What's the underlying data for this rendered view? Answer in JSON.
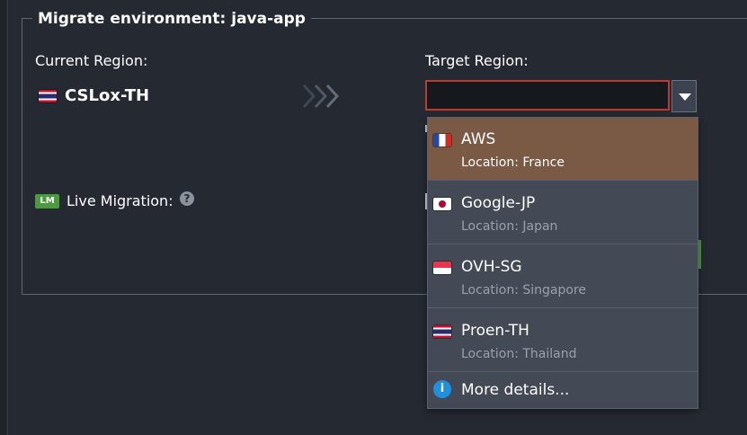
{
  "dialog": {
    "title": "Migrate environment: java-app"
  },
  "source": {
    "label": "Current Region:",
    "flag": "flag-thailand",
    "name": "CSLox-TH"
  },
  "target": {
    "label": "Target Region:",
    "value": "",
    "error_border_color": "#c0392b"
  },
  "live_migration": {
    "badge": "LM",
    "label": "Live Migration:",
    "help_icon": "question-circle-icon"
  },
  "dropdown": {
    "options": [
      {
        "name": "AWS",
        "location": "Location: France",
        "flag": "flag-france",
        "selected": true
      },
      {
        "name": "Google-JP",
        "location": "Location: Japan",
        "flag": "flag-japan",
        "selected": false
      },
      {
        "name": "OVH-SG",
        "location": "Location: Singapore",
        "flag": "flag-singapore",
        "selected": false
      },
      {
        "name": "Proen-TH",
        "location": "Location: Thailand",
        "flag": "flag-thailand",
        "selected": false
      }
    ],
    "more_icon": "info-icon",
    "more_label": "More details..."
  },
  "colors": {
    "background": "#252a32",
    "selected_item": "#7a5a45",
    "badge_green": "#4a9a3e",
    "info_blue": "#1e90e0"
  }
}
